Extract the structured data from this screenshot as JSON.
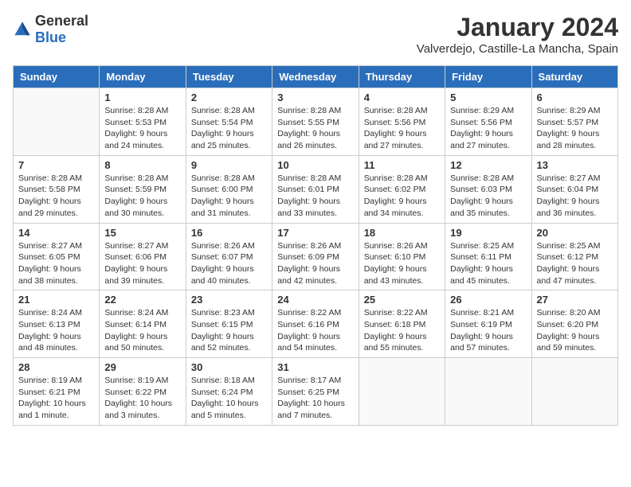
{
  "logo": {
    "general": "General",
    "blue": "Blue"
  },
  "title": "January 2024",
  "location": "Valverdejo, Castille-La Mancha, Spain",
  "weekdays": [
    "Sunday",
    "Monday",
    "Tuesday",
    "Wednesday",
    "Thursday",
    "Friday",
    "Saturday"
  ],
  "weeks": [
    [
      {
        "day": "",
        "info": ""
      },
      {
        "day": "1",
        "info": "Sunrise: 8:28 AM\nSunset: 5:53 PM\nDaylight: 9 hours\nand 24 minutes."
      },
      {
        "day": "2",
        "info": "Sunrise: 8:28 AM\nSunset: 5:54 PM\nDaylight: 9 hours\nand 25 minutes."
      },
      {
        "day": "3",
        "info": "Sunrise: 8:28 AM\nSunset: 5:55 PM\nDaylight: 9 hours\nand 26 minutes."
      },
      {
        "day": "4",
        "info": "Sunrise: 8:28 AM\nSunset: 5:56 PM\nDaylight: 9 hours\nand 27 minutes."
      },
      {
        "day": "5",
        "info": "Sunrise: 8:29 AM\nSunset: 5:56 PM\nDaylight: 9 hours\nand 27 minutes."
      },
      {
        "day": "6",
        "info": "Sunrise: 8:29 AM\nSunset: 5:57 PM\nDaylight: 9 hours\nand 28 minutes."
      }
    ],
    [
      {
        "day": "7",
        "info": "Sunrise: 8:28 AM\nSunset: 5:58 PM\nDaylight: 9 hours\nand 29 minutes."
      },
      {
        "day": "8",
        "info": "Sunrise: 8:28 AM\nSunset: 5:59 PM\nDaylight: 9 hours\nand 30 minutes."
      },
      {
        "day": "9",
        "info": "Sunrise: 8:28 AM\nSunset: 6:00 PM\nDaylight: 9 hours\nand 31 minutes."
      },
      {
        "day": "10",
        "info": "Sunrise: 8:28 AM\nSunset: 6:01 PM\nDaylight: 9 hours\nand 33 minutes."
      },
      {
        "day": "11",
        "info": "Sunrise: 8:28 AM\nSunset: 6:02 PM\nDaylight: 9 hours\nand 34 minutes."
      },
      {
        "day": "12",
        "info": "Sunrise: 8:28 AM\nSunset: 6:03 PM\nDaylight: 9 hours\nand 35 minutes."
      },
      {
        "day": "13",
        "info": "Sunrise: 8:27 AM\nSunset: 6:04 PM\nDaylight: 9 hours\nand 36 minutes."
      }
    ],
    [
      {
        "day": "14",
        "info": "Sunrise: 8:27 AM\nSunset: 6:05 PM\nDaylight: 9 hours\nand 38 minutes."
      },
      {
        "day": "15",
        "info": "Sunrise: 8:27 AM\nSunset: 6:06 PM\nDaylight: 9 hours\nand 39 minutes."
      },
      {
        "day": "16",
        "info": "Sunrise: 8:26 AM\nSunset: 6:07 PM\nDaylight: 9 hours\nand 40 minutes."
      },
      {
        "day": "17",
        "info": "Sunrise: 8:26 AM\nSunset: 6:09 PM\nDaylight: 9 hours\nand 42 minutes."
      },
      {
        "day": "18",
        "info": "Sunrise: 8:26 AM\nSunset: 6:10 PM\nDaylight: 9 hours\nand 43 minutes."
      },
      {
        "day": "19",
        "info": "Sunrise: 8:25 AM\nSunset: 6:11 PM\nDaylight: 9 hours\nand 45 minutes."
      },
      {
        "day": "20",
        "info": "Sunrise: 8:25 AM\nSunset: 6:12 PM\nDaylight: 9 hours\nand 47 minutes."
      }
    ],
    [
      {
        "day": "21",
        "info": "Sunrise: 8:24 AM\nSunset: 6:13 PM\nDaylight: 9 hours\nand 48 minutes."
      },
      {
        "day": "22",
        "info": "Sunrise: 8:24 AM\nSunset: 6:14 PM\nDaylight: 9 hours\nand 50 minutes."
      },
      {
        "day": "23",
        "info": "Sunrise: 8:23 AM\nSunset: 6:15 PM\nDaylight: 9 hours\nand 52 minutes."
      },
      {
        "day": "24",
        "info": "Sunrise: 8:22 AM\nSunset: 6:16 PM\nDaylight: 9 hours\nand 54 minutes."
      },
      {
        "day": "25",
        "info": "Sunrise: 8:22 AM\nSunset: 6:18 PM\nDaylight: 9 hours\nand 55 minutes."
      },
      {
        "day": "26",
        "info": "Sunrise: 8:21 AM\nSunset: 6:19 PM\nDaylight: 9 hours\nand 57 minutes."
      },
      {
        "day": "27",
        "info": "Sunrise: 8:20 AM\nSunset: 6:20 PM\nDaylight: 9 hours\nand 59 minutes."
      }
    ],
    [
      {
        "day": "28",
        "info": "Sunrise: 8:19 AM\nSunset: 6:21 PM\nDaylight: 10 hours\nand 1 minute."
      },
      {
        "day": "29",
        "info": "Sunrise: 8:19 AM\nSunset: 6:22 PM\nDaylight: 10 hours\nand 3 minutes."
      },
      {
        "day": "30",
        "info": "Sunrise: 8:18 AM\nSunset: 6:24 PM\nDaylight: 10 hours\nand 5 minutes."
      },
      {
        "day": "31",
        "info": "Sunrise: 8:17 AM\nSunset: 6:25 PM\nDaylight: 10 hours\nand 7 minutes."
      },
      {
        "day": "",
        "info": ""
      },
      {
        "day": "",
        "info": ""
      },
      {
        "day": "",
        "info": ""
      }
    ]
  ]
}
